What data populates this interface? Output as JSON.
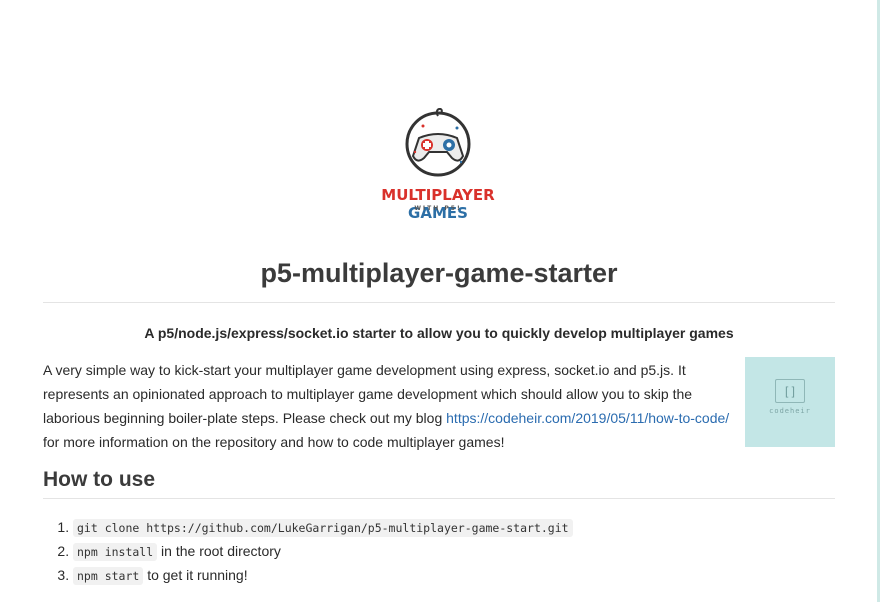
{
  "logo": {
    "word_red": "MULTIPLAYER",
    "word_blue": "GAMES",
    "sub": "WITH P5!",
    "colors": {
      "red": "#d9312b",
      "blue": "#2c6fa6"
    }
  },
  "title": "p5-multiplayer-game-starter",
  "subtitle": "A p5/node.js/express/socket.io starter to allow you to quickly develop multiplayer games",
  "description": {
    "text_before": "A very simple way to kick-start your multiplayer game development using express, socket.io and p5.js. It represents an opinionated approach to multiplayer game development which should allow you to skip the laborious beginning boiler-plate steps. Please check out my blog ",
    "link": "https://codeheir.com/2019/05/11/how-to-code/",
    "text_after": " for more information on the repository and how to code multiplayer games!"
  },
  "side_image": {
    "glyph": "[ ]",
    "word": "codeheir"
  },
  "how_to": {
    "heading": "How to use",
    "steps": [
      {
        "code": "git clone https://github.com/LukeGarrigan/p5-multiplayer-game-start.git",
        "text": ""
      },
      {
        "code": "npm install",
        "text": " in the root directory"
      },
      {
        "code": "npm start",
        "text": " to get it running!"
      }
    ]
  }
}
